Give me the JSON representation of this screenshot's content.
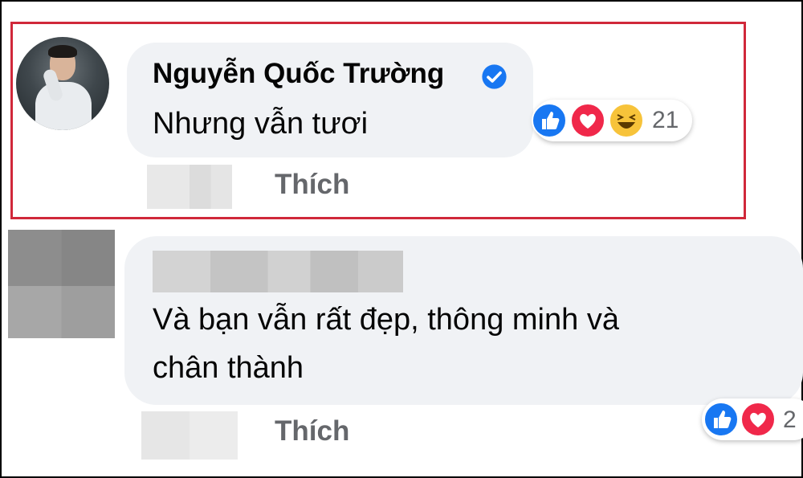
{
  "comment1": {
    "author": "Nguyễn Quốc Trường",
    "verified": true,
    "text": "Nhưng vẫn tươi",
    "reactions": [
      "like-icon",
      "love-icon",
      "haha-icon"
    ],
    "reaction_count": "21",
    "like_action": "Thích",
    "highlight_color": "#d0283a"
  },
  "comment2": {
    "text_line1": "Và bạn vẫn rất đẹp, thông minh và",
    "text_line2": "chân thành",
    "reactions": [
      "like-icon",
      "love-icon"
    ],
    "reaction_count": "2",
    "like_action": "Thích"
  },
  "colors": {
    "bubble": "#f0f2f5",
    "like": "#1877f2",
    "love": "#f0284a",
    "haha": "#f7c33a",
    "secondary_text": "#65676b"
  }
}
